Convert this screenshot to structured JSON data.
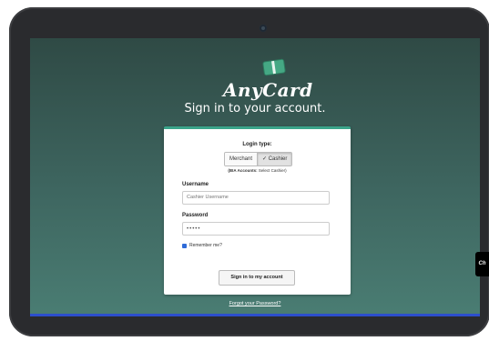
{
  "app": {
    "logo_text": "AnyCard"
  },
  "page": {
    "title": "Sign in to your account."
  },
  "login_form": {
    "login_type_label": "Login type:",
    "login_types": [
      "Merchant",
      "✓ Cashier"
    ],
    "selected_login_type": "Cashier",
    "note_bold": "(BIA Accounts:",
    "note_rest": " Select Cashier)",
    "username_label": "Username",
    "username_placeholder": "Cashier Username",
    "password_label": "Password",
    "password_value": "•••••",
    "remember_label": "Remember me?",
    "remember_checked": true,
    "submit_label": "Sign in to my account"
  },
  "footer": {
    "forgot_link": "Forgot your Password?"
  },
  "side_tab": {
    "label": "Ch"
  },
  "colors": {
    "accent": "#3aa48a",
    "background_top": "#2f4a45",
    "background_bottom": "#4a7d73"
  }
}
